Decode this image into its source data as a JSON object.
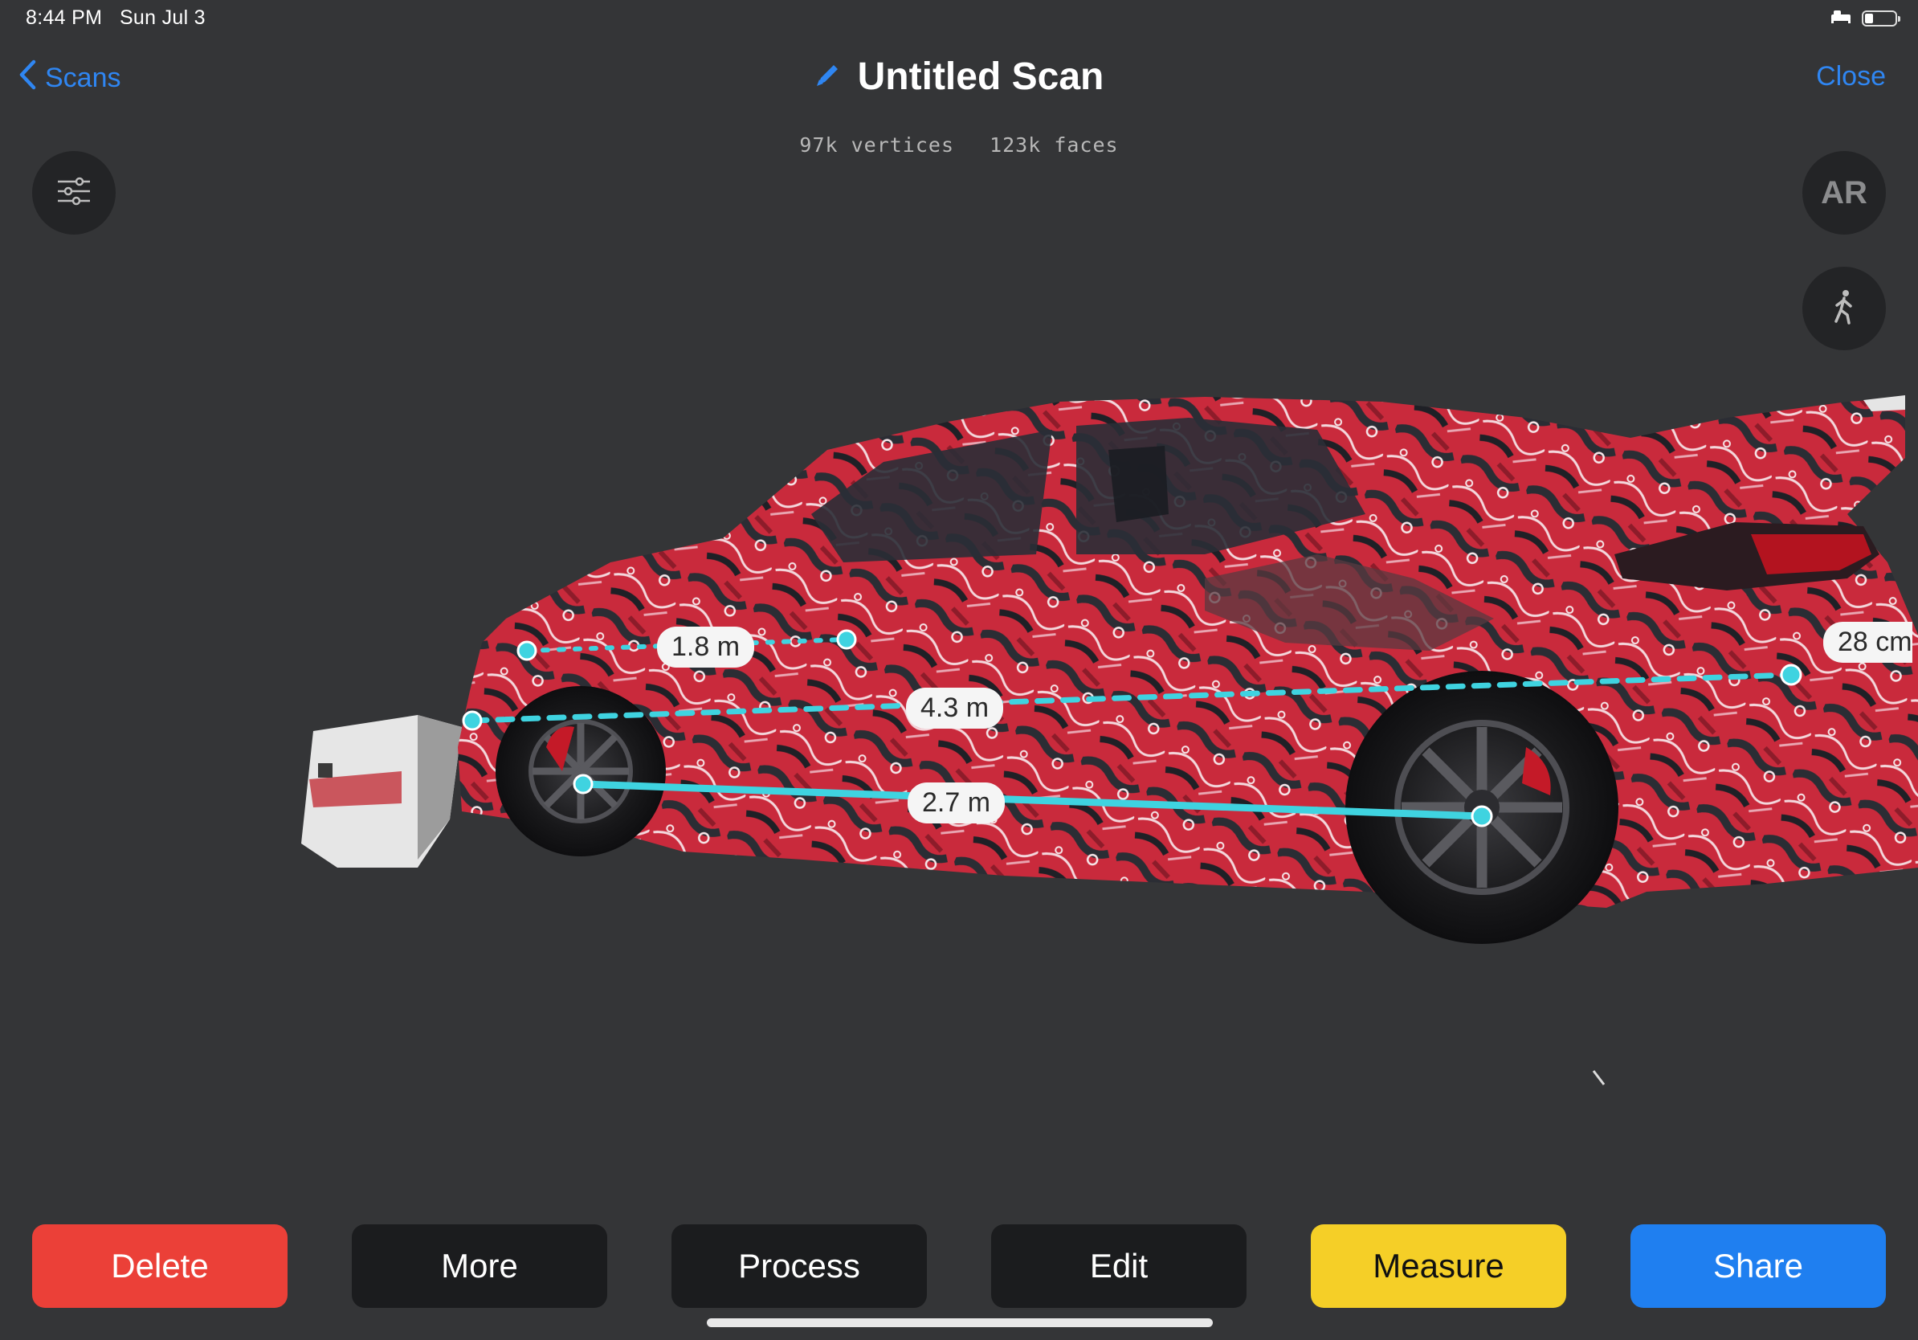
{
  "status_bar": {
    "time": "8:44 PM",
    "date": "Sun Jul 3"
  },
  "nav": {
    "back_label": "Scans",
    "title": "Untitled Scan",
    "close_label": "Close"
  },
  "stats": {
    "vertices": "97k vertices",
    "faces": "123k faces"
  },
  "side_buttons": {
    "ar_label": "AR"
  },
  "measurements": [
    "1.8 m",
    "4.3 m",
    "2.7 m",
    "28 cm"
  ],
  "toolbar": {
    "delete": "Delete",
    "more": "More",
    "process": "Process",
    "edit": "Edit",
    "measure": "Measure",
    "share": "Share"
  },
  "colors": {
    "background": "#343537",
    "accent_blue": "#2f86f2",
    "measure_line": "#3fd3e0",
    "delete_red": "#eb4038",
    "measure_yellow": "#f5cf27",
    "share_blue": "#1f7ff0"
  }
}
